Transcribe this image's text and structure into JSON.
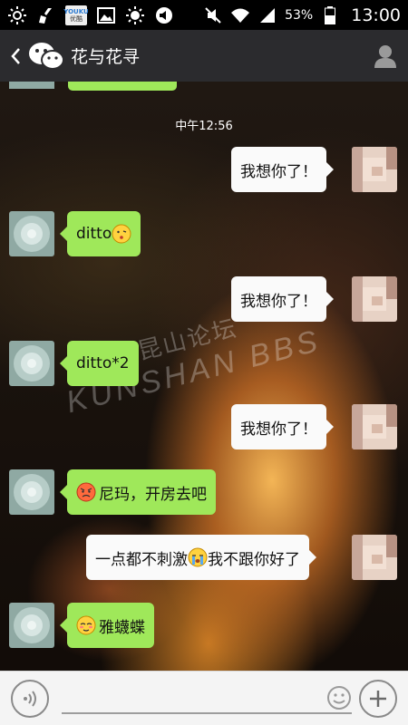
{
  "status_bar": {
    "icons": [
      "brightness-icon",
      "cleaner-icon",
      "youku-app-icon",
      "gallery-icon",
      "brightness-icon",
      "volume-icon"
    ],
    "youku_label": "YOUKU",
    "youku_sub": "优酷",
    "right_icons": [
      "mute-icon",
      "wifi-icon",
      "signal-icon",
      "battery-icon"
    ],
    "battery": "53%",
    "time": "13:00"
  },
  "header": {
    "back_icon": "back-chevron-icon",
    "logo_icon": "wechat-icon",
    "title": "花与花寻",
    "profile_icon": "profile-icon"
  },
  "chat": {
    "timestamp": "中午12:56",
    "watermark_cn": "昆山论坛",
    "watermark_en": "KUNSHAN BBS",
    "messages": [
      {
        "side": "sent",
        "text": "我想你了！"
      },
      {
        "side": "received",
        "text": "ditto",
        "emoji_after": "kiss-face-emoji"
      },
      {
        "side": "sent",
        "text": "我想你了！"
      },
      {
        "side": "received",
        "text": "ditto*2"
      },
      {
        "side": "sent",
        "text": "我想你了！"
      },
      {
        "side": "received",
        "text": "尼玛，开房去吧",
        "emoji_before": "angry-face-emoji"
      },
      {
        "side": "sent",
        "text_before": "一点都不刺激",
        "emoji": "crying-face-emoji",
        "text_after": "我不跟你好了"
      },
      {
        "side": "received",
        "text": "雅蠛蝶",
        "emoji_before": "blushing-face-emoji"
      }
    ]
  },
  "input_bar": {
    "voice_icon": "voice-icon",
    "placeholder": "",
    "emoji_icon": "smiley-icon",
    "more_icon": "plus-icon"
  },
  "colors": {
    "received_bubble": "#9fe85a",
    "sent_bubble": "#fafafa",
    "header": "#2b2b2e"
  }
}
